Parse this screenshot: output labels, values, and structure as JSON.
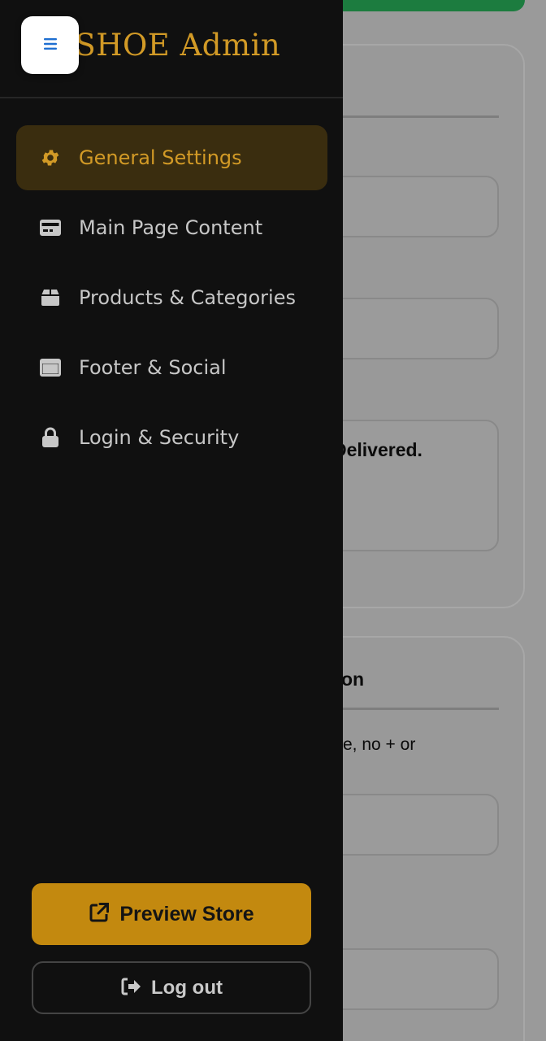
{
  "brand": {
    "title": "RSHOE Admin"
  },
  "menu_toggle": {
    "icon": "hamburger-icon",
    "color": "#1f6fd1"
  },
  "nav": {
    "items": [
      {
        "label": "General Settings",
        "icon": "gear-icon",
        "active": true
      },
      {
        "label": "Main Page Content",
        "icon": "card-layout-icon",
        "active": false
      },
      {
        "label": "Products & Categories",
        "icon": "box-icon",
        "active": false
      },
      {
        "label": "Footer & Social",
        "icon": "window-icon",
        "active": false
      },
      {
        "label": "Login & Security",
        "icon": "lock-icon",
        "active": false
      }
    ]
  },
  "actions": {
    "preview_label": "Preview Store",
    "preview_icon": "external-link-icon",
    "logout_label": "Log out",
    "logout_icon": "sign-out-icon"
  },
  "background": {
    "card1_text": "Delivered.",
    "card2_heading": "on",
    "card2_text": "e, no + or"
  },
  "colors": {
    "accent": "#d29a26",
    "drawer_bg": "#101010",
    "active_bg": "#3a2d0f",
    "preview_btn": "#c3890f",
    "topbar_green": "#1c7c3f"
  }
}
